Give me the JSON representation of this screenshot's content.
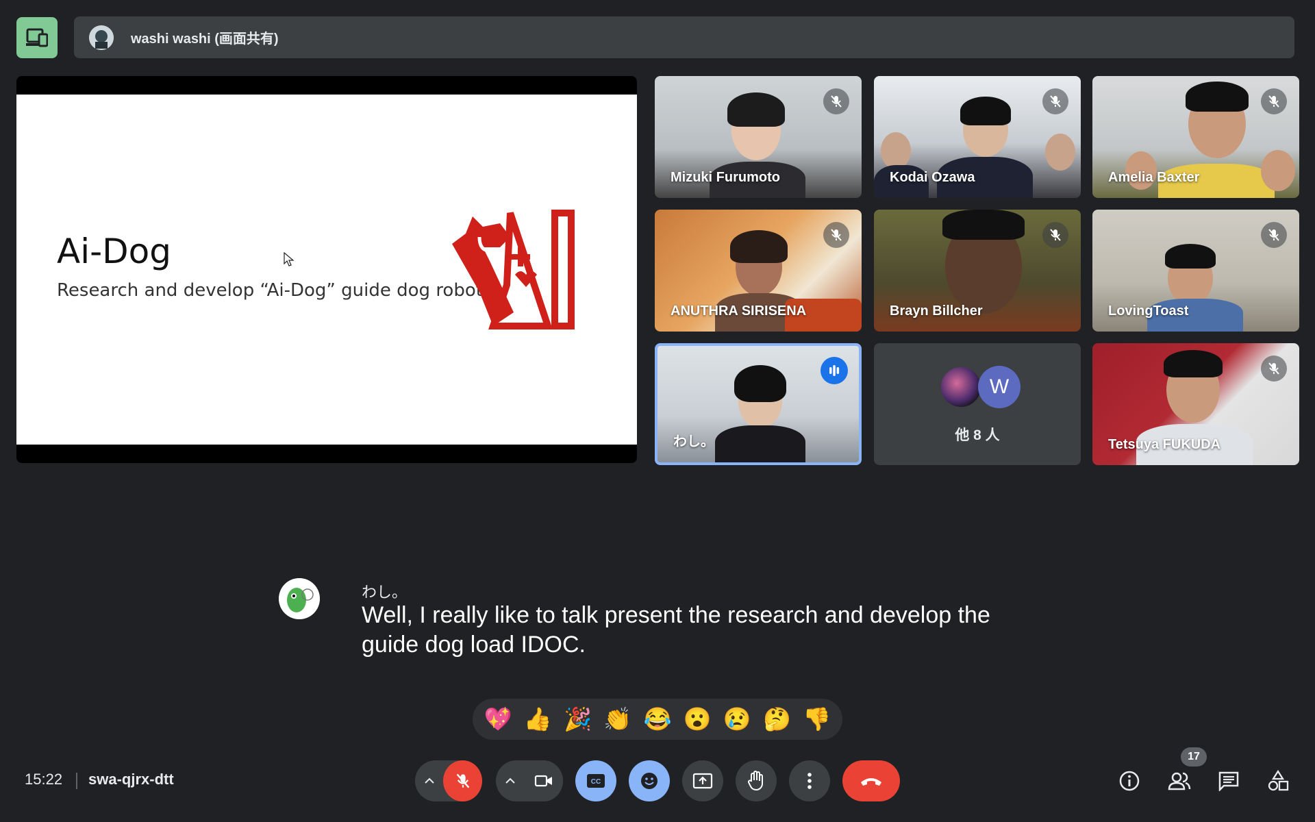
{
  "presentation": {
    "presenter_label": "washi washi (画面共有)"
  },
  "slide": {
    "title": "Ai-Dog",
    "subtitle": "Research and develop “Ai-Dog” guide dog robot",
    "logo_color": "#d0201a"
  },
  "participants": [
    {
      "name": "Mizuki Furumoto",
      "muted": true
    },
    {
      "name": "Kodai Ozawa",
      "muted": true
    },
    {
      "name": "Amelia Baxter",
      "muted": true
    },
    {
      "name": "ANUTHRA SIRISENA",
      "muted": true
    },
    {
      "name": "Brayn Billcher",
      "muted": true
    },
    {
      "name": "LovingToast",
      "muted": true
    },
    {
      "name": "わし。",
      "muted": false,
      "speaking": true
    },
    {
      "name": "Tetsuya FUKUDA",
      "muted": true
    }
  ],
  "others_tile": {
    "avatar_letter": "W",
    "label": "他 8 人"
  },
  "caption": {
    "speaker": "わし。",
    "text": "Well, I really like to talk present the research and develop the guide dog load IDOC."
  },
  "reactions": [
    "💖",
    "👍",
    "🎉",
    "👏",
    "😂",
    "😮",
    "😢",
    "🤔",
    "👎"
  ],
  "meeting": {
    "time": "15:22",
    "code": "swa-qjrx-dtt",
    "participant_count": "17"
  },
  "colors": {
    "background": "#202124",
    "accent_blue": "#8ab4f8",
    "end_call_red": "#ea4335",
    "present_green": "#81c995"
  }
}
